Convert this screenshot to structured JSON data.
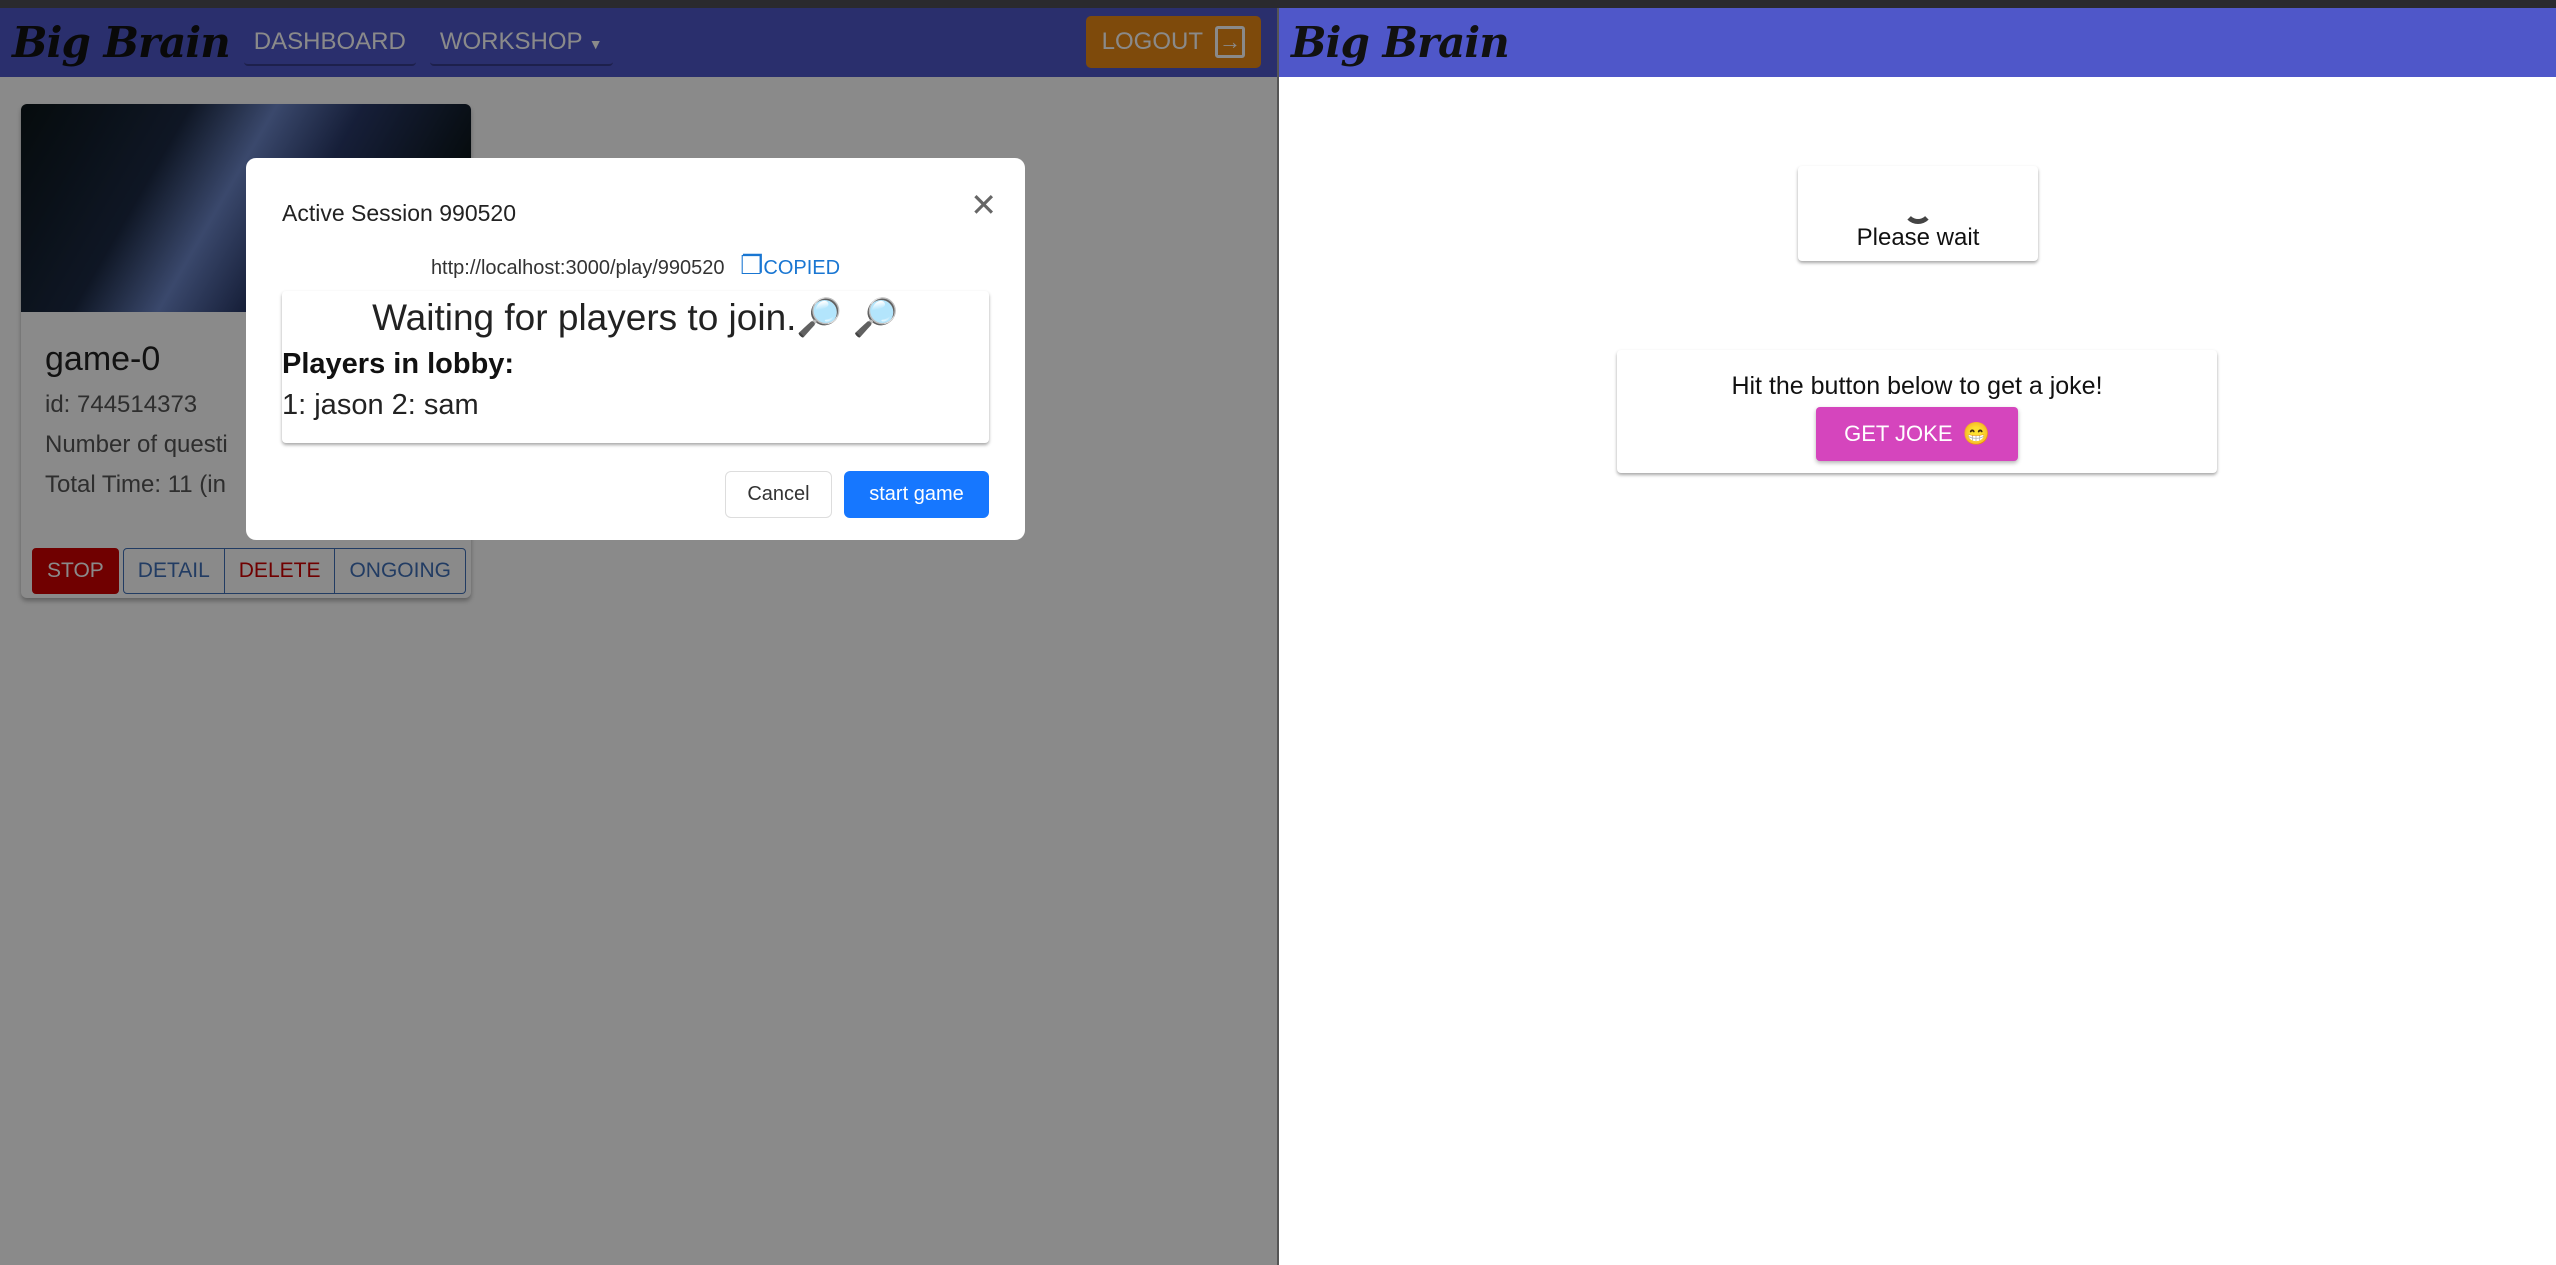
{
  "left_app": {
    "logo": "Big Brain",
    "nav": {
      "dashboard": "DASHBOARD",
      "workshop": "WORKSHOP",
      "logout": "LOGOUT"
    },
    "card": {
      "title": "game-0",
      "id": "id: 744514373",
      "questions": "Number of questi",
      "total_time": "Total Time: 11 (in",
      "buttons": {
        "stop": "STOP",
        "detail": "DETAIL",
        "delete": "DELETE",
        "ongoing": "ONGOING"
      }
    },
    "modal": {
      "title": "Active Session 990520",
      "url": "http://localhost:3000/play/990520",
      "copied": "COPIED",
      "waiting": "Waiting for players to join.🔎 🔎",
      "players_label": "Players in lobby:",
      "players": "1: jason 2: sam",
      "cancel": "Cancel",
      "start": "start game"
    }
  },
  "right_app": {
    "logo": "Big Brain",
    "loading": "Please wait",
    "joke_prompt": "Hit the button below to get a joke!",
    "joke_button": "GET JOKE",
    "joke_emoji": "😁"
  },
  "colors": {
    "navbar": "#4f57c9",
    "logout": "#e98a16",
    "stop": "#d00000",
    "primary": "#1677ff",
    "joke": "#d545bd"
  }
}
